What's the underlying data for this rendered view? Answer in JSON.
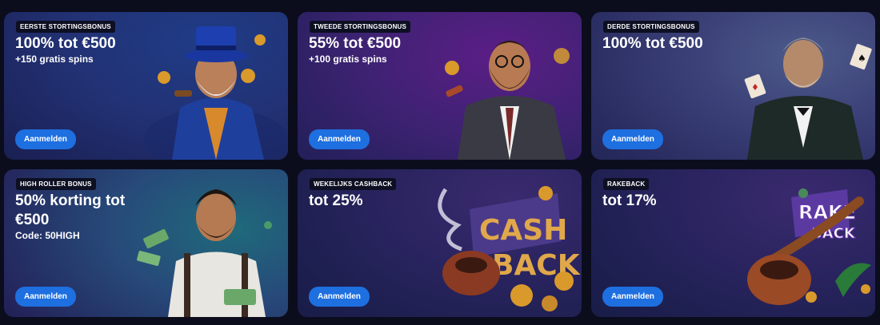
{
  "cards": [
    {
      "tag": "EERSTE STORTINGSBONUS",
      "headline": "100% tot €500",
      "sub": "+150 gratis spins",
      "button": "Aanmelden"
    },
    {
      "tag": "TWEEDE STORTINGSBONUS",
      "headline": "55% tot €500",
      "sub": "+100 gratis spins",
      "button": "Aanmelden"
    },
    {
      "tag": "DERDE STORTINGSBONUS",
      "headline": "100% tot €500",
      "sub": "",
      "button": "Aanmelden"
    },
    {
      "tag": "HIGH ROLLER BONUS",
      "headline": "50% korting tot €500",
      "sub": "Code: 50HIGH",
      "button": "Aanmelden"
    },
    {
      "tag": "WEKELIJKS CASHBACK",
      "headline": "tot 25%",
      "sub": "",
      "button": "Aanmelden"
    },
    {
      "tag": "RAKEBACK",
      "headline": "tot 17%",
      "sub": "",
      "button": "Aanmelden"
    }
  ],
  "art_text": {
    "cash": "CASH",
    "back": "BACK",
    "rake": "RAKE",
    "rake_back": "BACK"
  },
  "colors": {
    "button": "#1e6fe0",
    "tag_bg": "#0d0f22",
    "gold": "#d99a2b"
  }
}
